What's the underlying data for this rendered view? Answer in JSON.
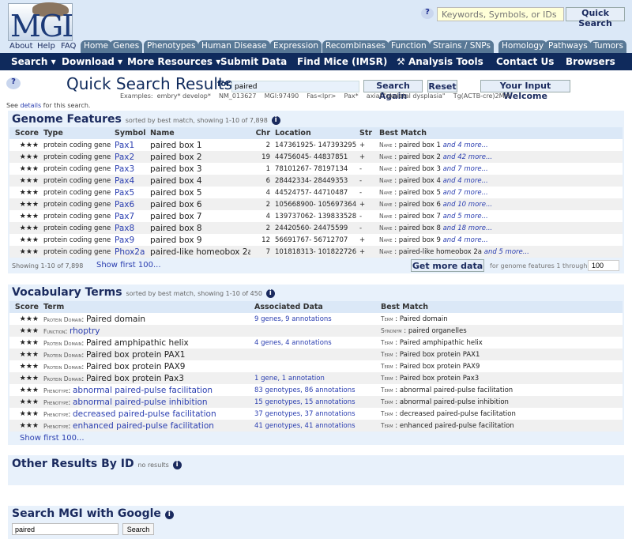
{
  "header": {
    "logo": "MGI",
    "quick_search_placeholder": "Keywords, Symbols, or IDs",
    "quick_search_button": "Quick Search",
    "help_icon": "question-icon",
    "util_links": [
      "About",
      "Help",
      "FAQ"
    ],
    "tabs": [
      "Home",
      "Genes",
      "Phenotypes",
      "Human Disease",
      "Expression",
      "Recombinases",
      "Function",
      "Strains / SNPs",
      "Homology",
      "Pathways",
      "Tumors"
    ]
  },
  "nav": [
    "Search ▾",
    "Download ▾",
    "More Resources ▾",
    "Submit Data",
    "Find Mice (IMSR)",
    "Analysis Tools",
    "Contact Us",
    "Browsers"
  ],
  "search": {
    "title": "Quick Search Results",
    "for_label": "for:",
    "query": "paired",
    "search_again": "Search Again",
    "reset": "Reset",
    "input_welcome": "Your Input Welcome",
    "examples": "Examples:  embry* develop*    NM_013627    MGI:97490    Fas<lpr>    Pax*    axial \"skeletal dysplasia\"    Tg(ACTB-cre)2Mrt",
    "details_pre": "See ",
    "details_link": "details",
    "details_post": " for this search."
  },
  "genome": {
    "title": "Genome Features",
    "subtitle": "sorted by best match, showing 1-10 of 7,898",
    "columns": [
      "Score",
      "Type",
      "Symbol",
      "Name",
      "Chr",
      "Location",
      "Str",
      "Best Match"
    ],
    "rows": [
      {
        "score": "★★★",
        "type": "protein coding gene",
        "symbol": "Pax1",
        "name": "paired box 1",
        "chr": "2",
        "loc": "147361925- 147393295",
        "str": "+",
        "mt": "Name",
        "mv": "paired box 1",
        "more": "and 4 more..."
      },
      {
        "score": "★★★",
        "type": "protein coding gene",
        "symbol": "Pax2",
        "name": "paired box 2",
        "chr": "19",
        "loc": "44756045- 44837851",
        "str": "+",
        "mt": "Name",
        "mv": "paired box 2",
        "more": "and 42 more..."
      },
      {
        "score": "★★★",
        "type": "protein coding gene",
        "symbol": "Pax3",
        "name": "paired box 3",
        "chr": "1",
        "loc": "78101267- 78197134",
        "str": "-",
        "mt": "Name",
        "mv": "paired box 3",
        "more": "and 7 more..."
      },
      {
        "score": "★★★",
        "type": "protein coding gene",
        "symbol": "Pax4",
        "name": "paired box 4",
        "chr": "6",
        "loc": "28442334- 28449353",
        "str": "-",
        "mt": "Name",
        "mv": "paired box 4",
        "more": "and 4 more..."
      },
      {
        "score": "★★★",
        "type": "protein coding gene",
        "symbol": "Pax5",
        "name": "paired box 5",
        "chr": "4",
        "loc": "44524757- 44710487",
        "str": "-",
        "mt": "Name",
        "mv": "paired box 5",
        "more": "and 7 more..."
      },
      {
        "score": "★★★",
        "type": "protein coding gene",
        "symbol": "Pax6",
        "name": "paired box 6",
        "chr": "2",
        "loc": "105668900- 105697364",
        "str": "+",
        "mt": "Name",
        "mv": "paired box 6",
        "more": "and 10 more..."
      },
      {
        "score": "★★★",
        "type": "protein coding gene",
        "symbol": "Pax7",
        "name": "paired box 7",
        "chr": "4",
        "loc": "139737062- 139833528",
        "str": "-",
        "mt": "Name",
        "mv": "paired box 7",
        "more": "and 5 more..."
      },
      {
        "score": "★★★",
        "type": "protein coding gene",
        "symbol": "Pax8",
        "name": "paired box 8",
        "chr": "2",
        "loc": "24420560- 24475599",
        "str": "-",
        "mt": "Name",
        "mv": "paired box 8",
        "more": "and 18 more..."
      },
      {
        "score": "★★★",
        "type": "protein coding gene",
        "symbol": "Pax9",
        "name": "paired box 9",
        "chr": "12",
        "loc": "56691767- 56712707",
        "str": "+",
        "mt": "Name",
        "mv": "paired box 9",
        "more": "and 4 more..."
      },
      {
        "score": "★★★",
        "type": "protein coding gene",
        "symbol": "Phox2a",
        "name": "paired-like homeobox 2a",
        "chr": "7",
        "loc": "101818313- 101822726",
        "str": "+",
        "mt": "Name",
        "mv": "paired-like homeobox 2a",
        "more": "and 5 more..."
      }
    ],
    "showing": "Showing 1-10 of 7,898",
    "show_first": "Show first 100...",
    "get_more": "Get more data",
    "get_more_label": "for genome features 1 through",
    "get_more_value": "100"
  },
  "vocab": {
    "title": "Vocabulary Terms",
    "subtitle": "sorted by best match, showing 1-10 of 450",
    "columns": [
      "Score",
      "Term",
      "Associated Data",
      "Best Match"
    ],
    "rows": [
      {
        "score": "★★★",
        "cat": "Protein Domain",
        "term": "Paired domain",
        "link": false,
        "assoc": "9 genes, 9 annotations",
        "mt": "Term",
        "mv": "Paired domain"
      },
      {
        "score": "★★★",
        "cat": "Function",
        "term": "rhoptry",
        "link": true,
        "assoc": "",
        "mt": "Synonym",
        "mv": "paired organelles"
      },
      {
        "score": "★★★",
        "cat": "Protein Domain",
        "term": "Paired amphipathic helix",
        "link": false,
        "assoc": "4 genes, 4 annotations",
        "mt": "Term",
        "mv": "Paired amphipathic helix"
      },
      {
        "score": "★★★",
        "cat": "Protein Domain",
        "term": "Paired box protein PAX1",
        "link": false,
        "assoc": "",
        "mt": "Term",
        "mv": "Paired box protein PAX1"
      },
      {
        "score": "★★★",
        "cat": "Protein Domain",
        "term": "Paired box protein PAX9",
        "link": false,
        "assoc": "",
        "mt": "Term",
        "mv": "Paired box protein PAX9"
      },
      {
        "score": "★★★",
        "cat": "Protein Domain",
        "term": "Paired box protein Pax3",
        "link": false,
        "assoc": "1 gene, 1 annotation",
        "mt": "Term",
        "mv": "Paired box protein Pax3"
      },
      {
        "score": "★★★",
        "cat": "Phenotype",
        "term": "abnormal paired-pulse facilitation",
        "link": true,
        "assoc": "83 genotypes, 86 annotations",
        "mt": "Term",
        "mv": "abnormal paired-pulse facilitation"
      },
      {
        "score": "★★★",
        "cat": "Phenotype",
        "term": "abnormal paired-pulse inhibition",
        "link": true,
        "assoc": "15 genotypes, 15 annotations",
        "mt": "Term",
        "mv": "abnormal paired-pulse inhibition"
      },
      {
        "score": "★★★",
        "cat": "Phenotype",
        "term": "decreased paired-pulse facilitation",
        "link": true,
        "assoc": "37 genotypes, 37 annotations",
        "mt": "Term",
        "mv": "decreased paired-pulse facilitation"
      },
      {
        "score": "★★★",
        "cat": "Phenotype",
        "term": "enhanced paired-pulse facilitation",
        "link": true,
        "assoc": "41 genotypes, 41 annotations",
        "mt": "Term",
        "mv": "enhanced paired-pulse facilitation"
      }
    ],
    "show_first": "Show first 100..."
  },
  "other": {
    "title": "Other Results By ID",
    "subtitle": "no results"
  },
  "google": {
    "title": "Search MGI with Google",
    "query": "paired",
    "button": "Search"
  },
  "colors": {
    "nav": "#0f2a5c",
    "tab": "#587896",
    "section": "#e8f1fb",
    "link": "#2a3eb0"
  }
}
